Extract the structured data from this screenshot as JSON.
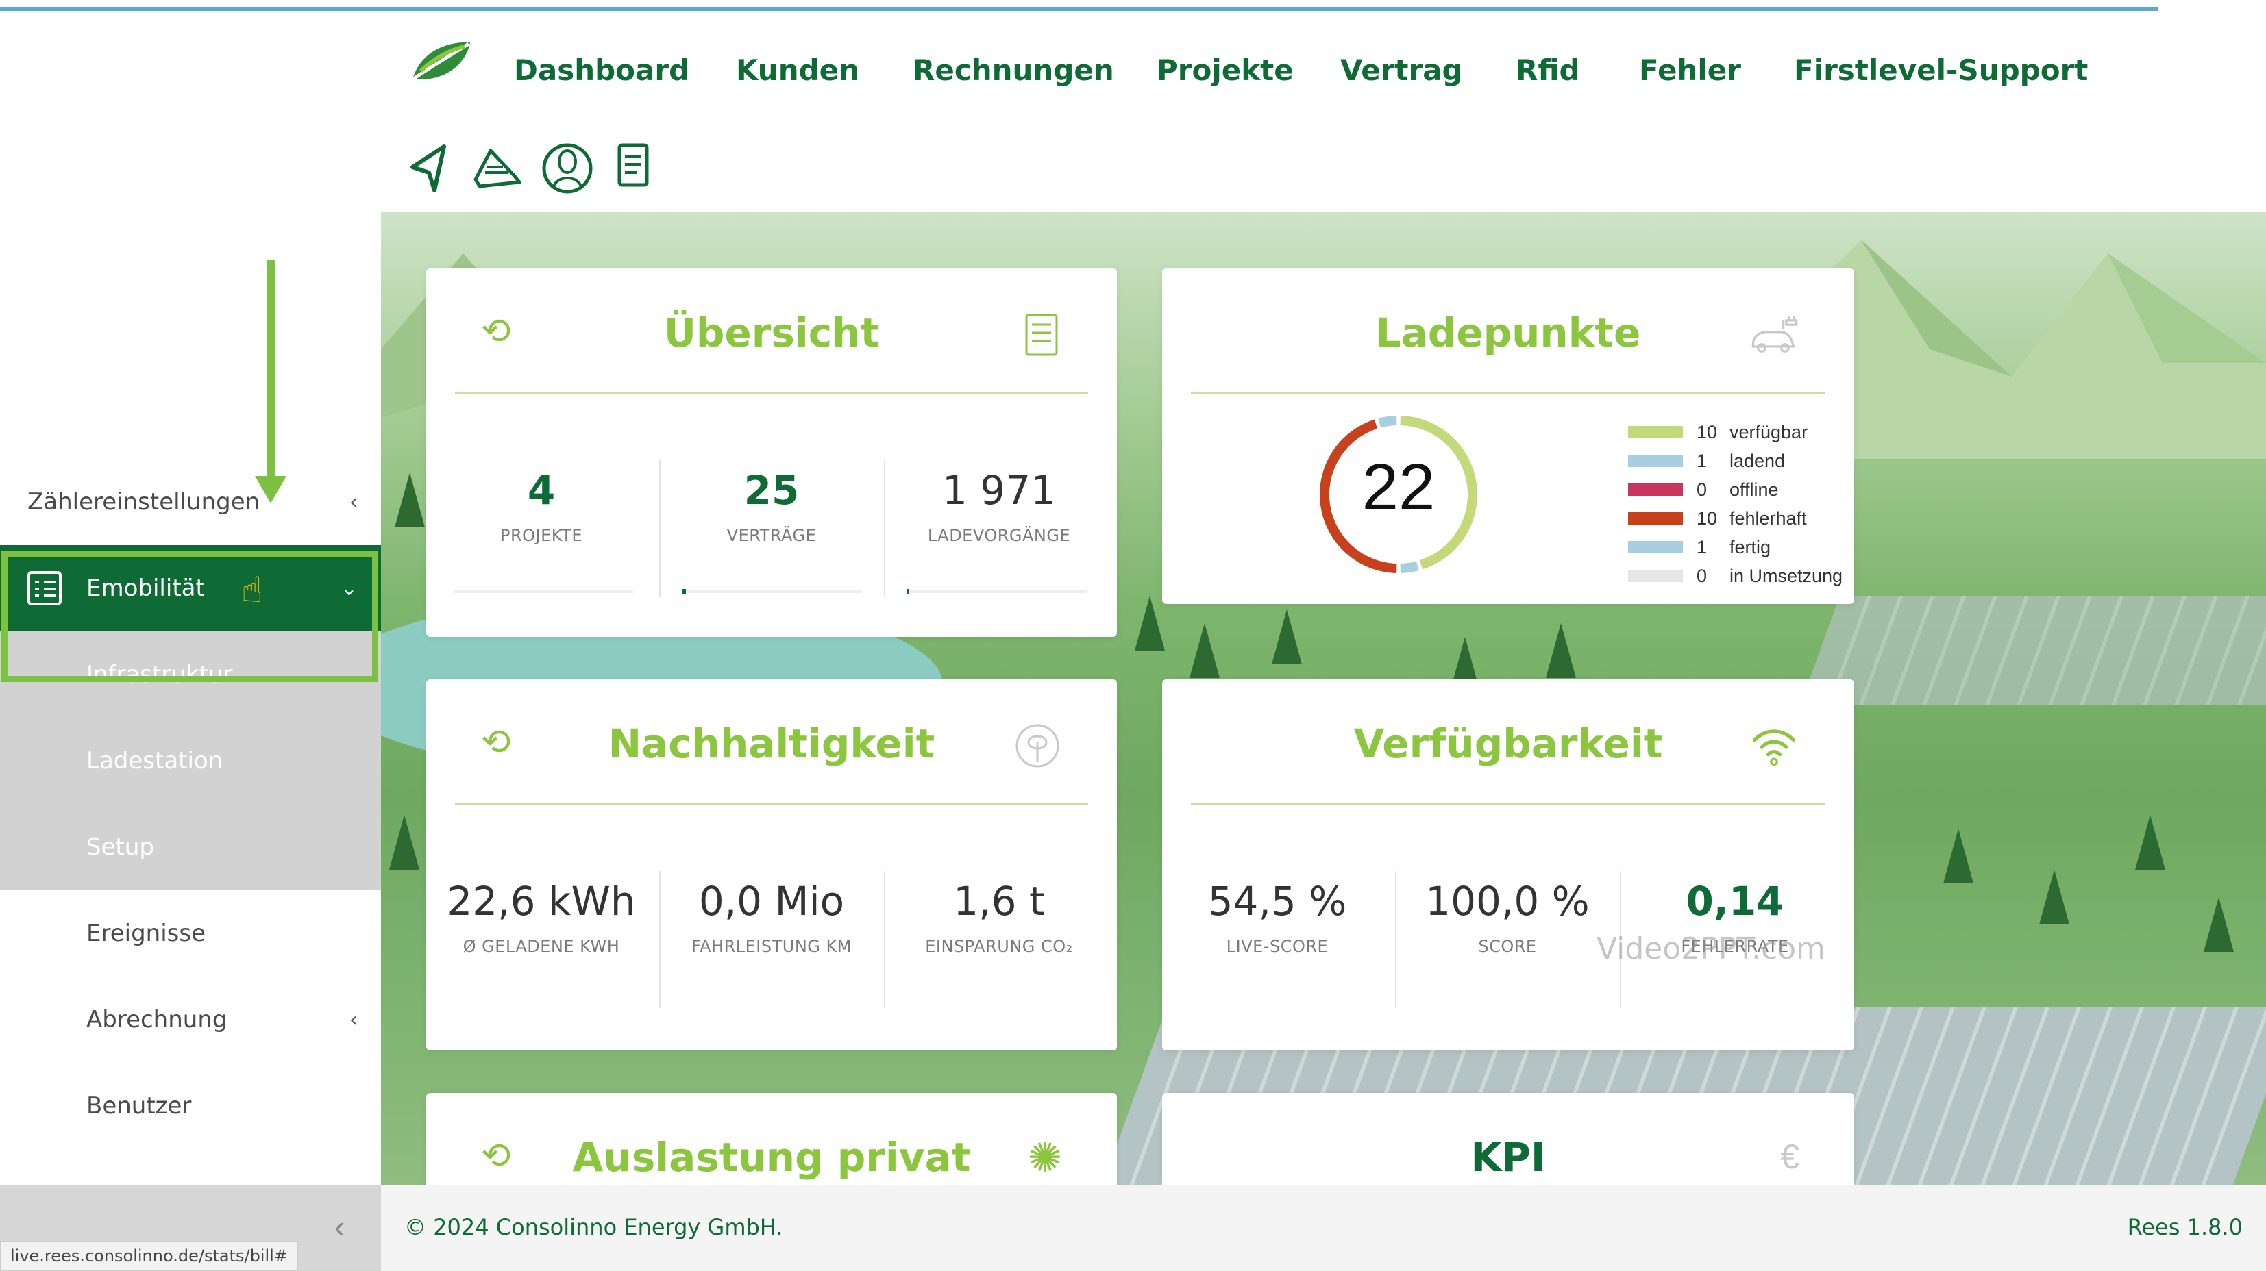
{
  "nav": {
    "links": [
      "Dashboard",
      "Kunden",
      "Rechnungen",
      "Projekte",
      "Vertrag",
      "Rfid",
      "Fehler",
      "Firstlevel-Support"
    ],
    "icons": [
      "leaf-logo-icon",
      "send-icon",
      "truck-icon",
      "user-circle-icon",
      "document-list-icon"
    ]
  },
  "sidebar": {
    "items": [
      {
        "label": "Zählereinstellungen",
        "chevron": "‹"
      },
      {
        "label": "Emobilität",
        "chevron": "⌄"
      },
      {
        "label": "Infrastruktur"
      },
      {
        "label": "Ladestation"
      },
      {
        "label": "Setup"
      },
      {
        "label": "Ereignisse"
      },
      {
        "label": "Abrechnung",
        "chevron": "‹"
      },
      {
        "label": "Benutzer"
      }
    ],
    "collapse": "‹",
    "status_url": "live.rees.consolinno.de/stats/bill#"
  },
  "cards": {
    "uebersicht": {
      "title": "Übersicht",
      "stats": [
        {
          "value": "4",
          "label": "PROJEKTE",
          "progress": 0.0
        },
        {
          "value": "25",
          "label": "VERTRÄGE",
          "progress": 0.02
        },
        {
          "value": "1 971",
          "label": "LADEVORGÄNGE",
          "progress": 0.01
        }
      ]
    },
    "ladepunkte": {
      "title": "Ladepunkte",
      "total": "22",
      "legend": [
        {
          "count": "10",
          "label": "verfügbar",
          "color": "#c4d97a"
        },
        {
          "count": "1",
          "label": "ladend",
          "color": "#a8cfe0"
        },
        {
          "count": "0",
          "label": "offline",
          "color": "#c8365e"
        },
        {
          "count": "10",
          "label": "fehlerhaft",
          "color": "#c8401c"
        },
        {
          "count": "1",
          "label": "fertig",
          "color": "#a8cfe0"
        },
        {
          "count": "0",
          "label": "in Umsetzung",
          "color": "#e6e6e6"
        }
      ]
    },
    "nachhaltigkeit": {
      "title": "Nachhaltigkeit",
      "stats": [
        {
          "value": "22,6 kWh",
          "label": "Ø GELADENE KWH"
        },
        {
          "value": "0,0 Mio",
          "label": "FAHRLEISTUNG KM"
        },
        {
          "value": "1,6 t",
          "label": "EINSPARUNG CO₂"
        }
      ]
    },
    "verfuegbarkeit": {
      "title": "Verfügbarkeit",
      "stats": [
        {
          "value": "54,5 %",
          "label": "LIVE-SCORE"
        },
        {
          "value": "100,0 %",
          "label": "SCORE"
        },
        {
          "value": "0,14",
          "label": "FEHLERRATE"
        }
      ]
    },
    "auslastung": {
      "title": "Auslastung privat"
    },
    "kpi": {
      "title": "KPI"
    }
  },
  "watermark": "Video2PPT.com",
  "footer": {
    "copyright": "© 2024 Consolinno Energy GmbH.",
    "version": "Rees 1.8.0"
  },
  "colors": {
    "brand_dark": "#0e6b35",
    "brand_light": "#8cc63f",
    "highlight_frame": "#7cc142"
  }
}
